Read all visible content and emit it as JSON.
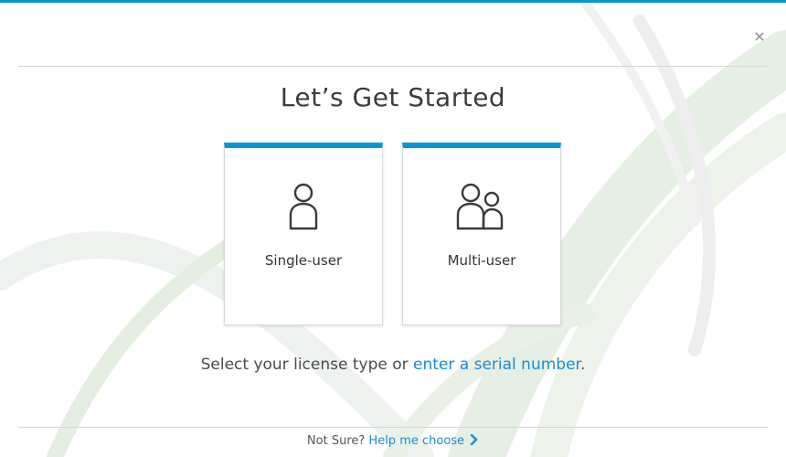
{
  "dialog": {
    "title": "Let’s Get Started",
    "close_symbol": "×"
  },
  "license_options": [
    {
      "label": "Single-user",
      "icon": "single-user-icon"
    },
    {
      "label": "Multi-user",
      "icon": "multi-user-icon"
    }
  ],
  "prompt": {
    "text_before": "Select your license type or ",
    "link_text": "enter a serial number",
    "text_after": "."
  },
  "footer": {
    "text": "Not Sure?",
    "link_text": "Help me choose",
    "icon": "chevron-right-icon"
  },
  "colors": {
    "accent": "#0696d7",
    "link": "#1a8bd1"
  }
}
